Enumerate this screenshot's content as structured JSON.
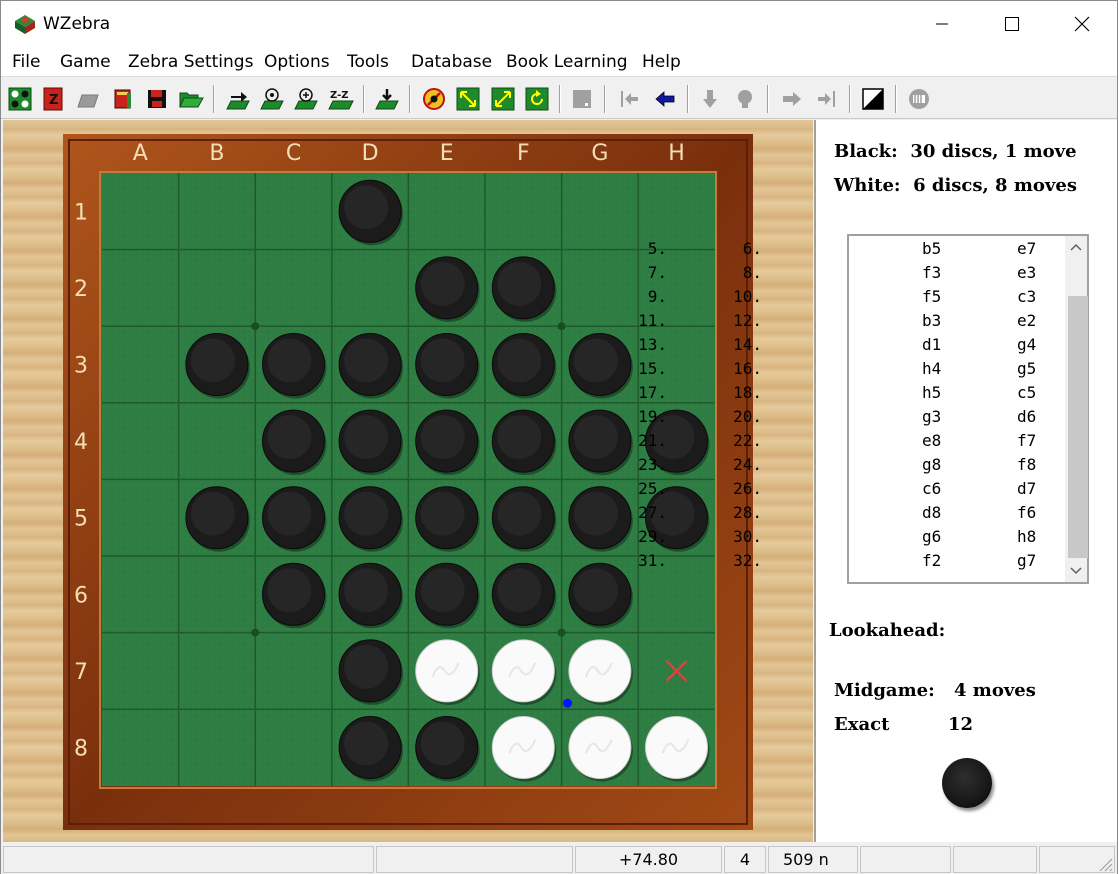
{
  "window": {
    "title": "WZebra"
  },
  "menu": [
    "File",
    "Game",
    "Zebra Settings",
    "Options",
    "Tools",
    "Database",
    "Book Learning",
    "Help"
  ],
  "toolbar": {
    "buttons": [
      "new-game-icon",
      "zebra-icon",
      "open-gray-icon",
      "book-icon",
      "save-icon",
      "open-folder-icon",
      "play-move-icon",
      "hint-icon",
      "analyze-icon",
      "zz-icon",
      "download-icon",
      "stop-icon",
      "flip-icon",
      "rotate-icon",
      "refresh-icon",
      "blank-icon",
      "first-move-icon",
      "back-move-icon",
      "down-icon",
      "bulb-icon",
      "forward-move-icon",
      "last-move-icon",
      "contrast-icon",
      "menu-icon"
    ]
  },
  "board": {
    "columns": [
      "A",
      "B",
      "C",
      "D",
      "E",
      "F",
      "G",
      "H"
    ],
    "rows": [
      "1",
      "2",
      "3",
      "4",
      "5",
      "6",
      "7",
      "8"
    ],
    "squares": [
      "...B....",
      "....BB..",
      ".BBBBBB.",
      "..BBBBBB",
      ".BBBBBBB",
      "..BBBBB.",
      "...BWWWX",
      "...BBWWW"
    ],
    "legend": {
      "B": "black disc",
      "W": "white disc",
      "X": "red cross marker",
      ".": "empty"
    },
    "colors": {
      "felt": "#2e7d43",
      "grid": "#1e5a2c",
      "frame": "#8b3a10",
      "marker": "#e04040",
      "last_move_dot": "#0018ff"
    }
  },
  "info": {
    "black": "Black:  30 discs, 1 move",
    "white": "White:  6 discs, 8 moves",
    "lookahead_label": "Lookahead:",
    "midgame_label": "Midgame:",
    "midgame_value": "4 moves",
    "exact_label": "Exact",
    "exact_value": "12",
    "to_move_color": "black"
  },
  "moves": [
    {
      "n1": "5.",
      "m1": "b5",
      "n2": "6.",
      "m2": "e7"
    },
    {
      "n1": "7.",
      "m1": "f3",
      "n2": "8.",
      "m2": "e3"
    },
    {
      "n1": "9.",
      "m1": "f5",
      "n2": "10.",
      "m2": "c3"
    },
    {
      "n1": "11.",
      "m1": "b3",
      "n2": "12.",
      "m2": "e2"
    },
    {
      "n1": "13.",
      "m1": "d1",
      "n2": "14.",
      "m2": "g4"
    },
    {
      "n1": "15.",
      "m1": "h4",
      "n2": "16.",
      "m2": "g5"
    },
    {
      "n1": "17.",
      "m1": "h5",
      "n2": "18.",
      "m2": "c5"
    },
    {
      "n1": "19.",
      "m1": "g3",
      "n2": "20.",
      "m2": "d6"
    },
    {
      "n1": "21.",
      "m1": "e8",
      "n2": "22.",
      "m2": "f7"
    },
    {
      "n1": "23.",
      "m1": "g8",
      "n2": "24.",
      "m2": "f8"
    },
    {
      "n1": "25.",
      "m1": "c6",
      "n2": "26.",
      "m2": "d7"
    },
    {
      "n1": "27.",
      "m1": "d8",
      "n2": "28.",
      "m2": "f6"
    },
    {
      "n1": "29.",
      "m1": "g6",
      "n2": "30.",
      "m2": "h8"
    },
    {
      "n1": "31.",
      "m1": "f2",
      "n2": "32.",
      "m2": "g7"
    }
  ],
  "status": {
    "eval": "+74.80",
    "depth": "4",
    "nodes": "509 n"
  }
}
